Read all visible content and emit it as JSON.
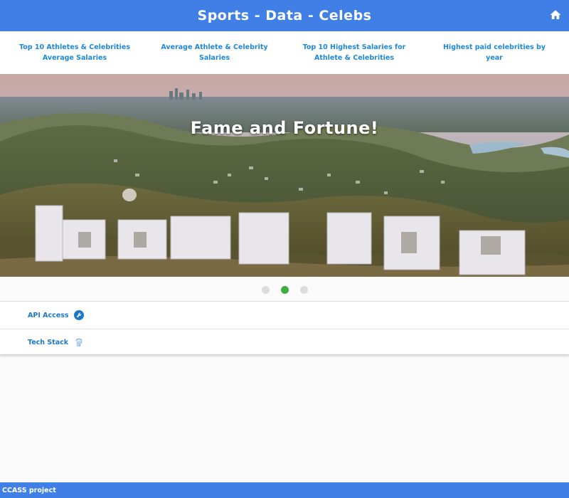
{
  "header": {
    "title": "Sports - Data - Celebs",
    "home_icon": "home-icon"
  },
  "nav": {
    "links": [
      {
        "label": "Top 10 Athletes & Celebrities Average Salaries"
      },
      {
        "label": "Average Athlete & Celebrity Salaries"
      },
      {
        "label": "Top 10 Highest Salaries for Athlete & Celebrities"
      },
      {
        "label": "Highest paid celebrities by year"
      }
    ]
  },
  "carousel": {
    "caption": "Fame and Fortune!",
    "slide_count": 3,
    "active_index": 1,
    "image": "hollywood-sign-photo"
  },
  "panel": {
    "rows": [
      {
        "label": "API Access",
        "icon": "wrench-icon"
      },
      {
        "label": "Tech Stack",
        "icon": "fingerprint-icon"
      }
    ]
  },
  "footer": {
    "text": "CCASS project"
  },
  "colors": {
    "primary": "#3f7fe6",
    "link": "#1e88d8",
    "active_dot": "#3cae3f"
  }
}
